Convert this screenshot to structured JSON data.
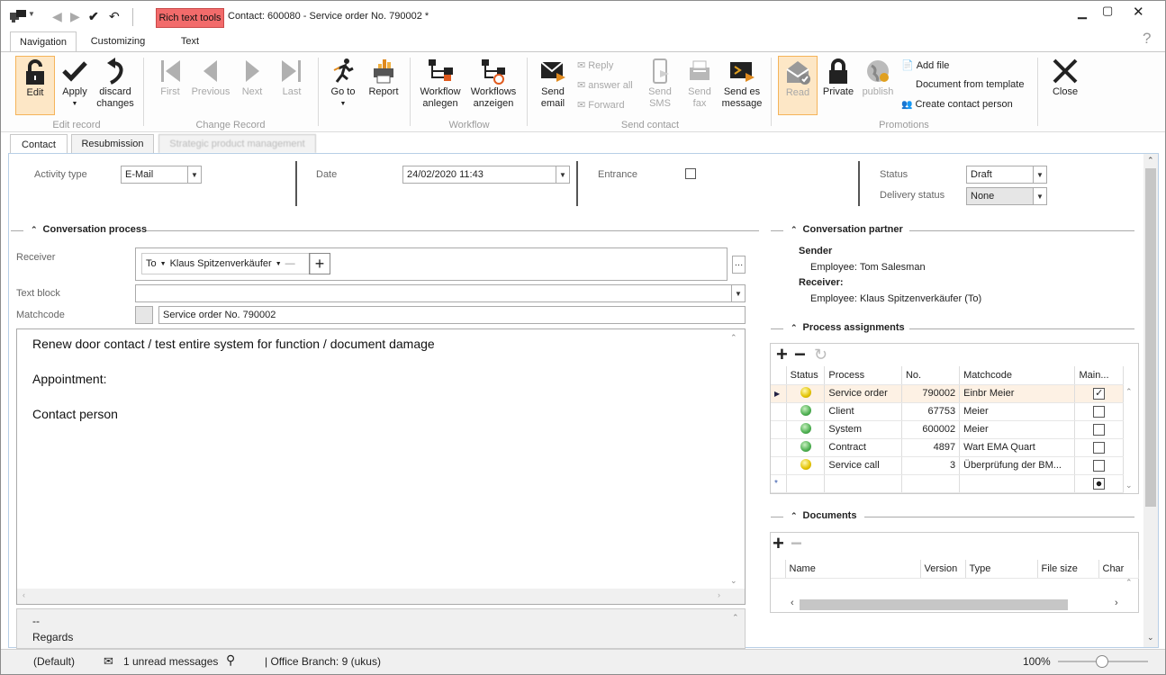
{
  "window": {
    "rich_text_tools": "Rich text tools",
    "title": "Contact: 600080 - Service order No. 790002 *"
  },
  "ribbon_tabs": {
    "navigation": "Navigation",
    "customizing": "Customizing",
    "text": "Text"
  },
  "ribbon": {
    "edit": "Edit",
    "apply": "Apply",
    "discard": "discard changes",
    "first": "First",
    "previous": "Previous",
    "next": "Next",
    "last": "Last",
    "go_to": "Go to",
    "report": "Report",
    "workflow_anlegen": "Workflow anlegen",
    "workflows_anzeigen": "Workflows anzeigen",
    "send_email": "Send email",
    "reply": "Reply",
    "answer_all": "answer all",
    "forward": "Forward",
    "send_sms": "Send SMS",
    "send_fax": "Send fax",
    "send_es_message": "Send es message",
    "read": "Read",
    "private": "Private",
    "publish": "publish",
    "add_file": "Add file",
    "doc_from_template": "Document from template",
    "create_contact_person": "Create contact person",
    "close": "Close",
    "groups": {
      "edit_record": "Edit record",
      "change_record": "Change Record",
      "workflow": "Workflow",
      "send_contact": "Send contact",
      "promotions": "Promotions"
    }
  },
  "doc_tabs": {
    "contact": "Contact",
    "resubmission": "Resubmission",
    "strategic": "Strategic product management"
  },
  "form": {
    "activity_type_label": "Activity type",
    "activity_type": "E-Mail",
    "date_label": "Date",
    "date": "24/02/2020 11:43",
    "entrance_label": "Entrance",
    "status_label": "Status",
    "status": "Draft",
    "delivery_status_label": "Delivery status",
    "delivery_status": "None"
  },
  "conversation": {
    "title": "Conversation process",
    "receiver_label": "Receiver",
    "to": "To",
    "receiver_name": "Klaus Spitzenverkäufer",
    "text_block_label": "Text block",
    "matchcode_label": "Matchcode",
    "matchcode": "Service order No. 790002",
    "body_line1": "Renew door contact / test entire system for function / document damage",
    "body_line2": "Appointment:",
    "body_line3": "Contact person",
    "signature_dash": "--",
    "signature_regards": "Regards"
  },
  "partner": {
    "title": "Conversation partner",
    "sender_label": "Sender",
    "sender": "Employee: Tom Salesman",
    "receiver_label": "Receiver:",
    "receiver": "Employee: Klaus Spitzenverkäufer (To)"
  },
  "process_assignments": {
    "title": "Process assignments",
    "columns": [
      "Status",
      "Process",
      "No.",
      "Matchcode",
      "Main..."
    ],
    "rows": [
      {
        "status": "yellow",
        "process": "Service order",
        "no": "790002",
        "matchcode": "Einbr Meier",
        "main": true
      },
      {
        "status": "green",
        "process": "Client",
        "no": "67753",
        "matchcode": "Meier",
        "main": false
      },
      {
        "status": "green",
        "process": "System",
        "no": "600002",
        "matchcode": "Meier",
        "main": false
      },
      {
        "status": "green",
        "process": "Contract",
        "no": "4897",
        "matchcode": "Wart EMA Quart",
        "main": false
      },
      {
        "status": "yellow",
        "process": "Service call",
        "no": "3",
        "matchcode": "Überprüfung der BM...",
        "main": false
      }
    ]
  },
  "documents": {
    "title": "Documents",
    "columns": [
      "Name",
      "Version",
      "Type",
      "File size",
      "Char"
    ]
  },
  "statusbar": {
    "default": "(Default)",
    "unread": "1 unread messages",
    "branch": "| Office Branch:  9 (ukus)",
    "zoom": "100%"
  }
}
